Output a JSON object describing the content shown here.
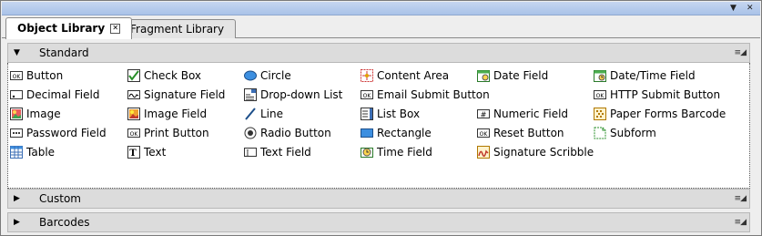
{
  "tabs": [
    {
      "label": "Object Library",
      "close": "✕"
    },
    {
      "label": "Fragment Library"
    }
  ],
  "sections": {
    "standard": "Standard",
    "custom": "Custom",
    "barcodes": "Barcodes"
  },
  "items": [
    {
      "label": "Button"
    },
    {
      "label": "Check Box"
    },
    {
      "label": "Circle"
    },
    {
      "label": "Content Area"
    },
    {
      "label": "Date Field"
    },
    {
      "label": "Date/Time Field"
    },
    {
      "label": "Decimal Field"
    },
    {
      "label": "Signature Field"
    },
    {
      "label": "Drop-down List"
    },
    {
      "label": "Email Submit Button"
    },
    {
      "label": "HTTP Submit Button"
    },
    {
      "label": "Image"
    },
    {
      "label": "Image Field"
    },
    {
      "label": "Line"
    },
    {
      "label": "List Box"
    },
    {
      "label": "Numeric Field"
    },
    {
      "label": "Paper Forms Barcode"
    },
    {
      "label": "Password Field"
    },
    {
      "label": "Print Button"
    },
    {
      "label": "Radio Button"
    },
    {
      "label": "Rectangle"
    },
    {
      "label": "Reset Button"
    },
    {
      "label": "Subform"
    },
    {
      "label": "Table"
    },
    {
      "label": "Text"
    },
    {
      "label": "Text Field"
    },
    {
      "label": "Time Field"
    },
    {
      "label": "Signature Scribble"
    }
  ],
  "icons": {
    "ok_text": "OK",
    "text_glyph": "T",
    "field_glyph": "I",
    "numeric_glyph": "#",
    "decimal_glyph": "•",
    "password_glyph": "•••"
  }
}
